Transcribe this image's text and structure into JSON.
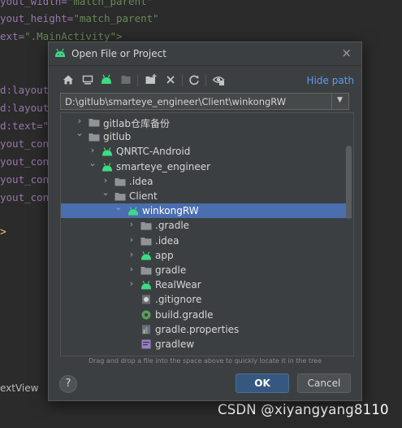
{
  "editor": {
    "lines": [
      {
        "a": "yout_width=",
        "v": "\"match_parent\""
      },
      {
        "a": "yout_height=",
        "v": "\"match_parent\""
      },
      {
        "a": "ext=",
        "v": "\".MainActivity\">"
      },
      {
        "a": "",
        "v": ""
      },
      {
        "a": "d:layout",
        "v": ""
      },
      {
        "a": "d:layout",
        "v": ""
      },
      {
        "a": "d:text=\"",
        "v": ""
      },
      {
        "a": "yout_con",
        "v": ""
      },
      {
        "a": "yout_con",
        "v": ""
      },
      {
        "a": "yout_con",
        "v": ""
      },
      {
        "a": "yout_con",
        "v": ""
      }
    ],
    "arrow": ">",
    "bottom_tab": "extView"
  },
  "dialog": {
    "title": "Open File or Project",
    "close": "×",
    "hide_path": "Hide path",
    "path_value": "D:\\gitlub\\smarteye_engineer\\Client\\winkongRW",
    "tree": [
      {
        "label": "gitlab仓库备份",
        "indent": 0,
        "chev": "›",
        "icon": "folder"
      },
      {
        "label": "gitlub",
        "indent": 0,
        "chev": "⌄",
        "icon": "folder"
      },
      {
        "label": "QNRTC-Android",
        "indent": 1,
        "chev": "›",
        "icon": "android"
      },
      {
        "label": "smarteye_engineer",
        "indent": 1,
        "chev": "⌄",
        "icon": "android"
      },
      {
        "label": ".idea",
        "indent": 2,
        "chev": "›",
        "icon": "folder"
      },
      {
        "label": "Client",
        "indent": 2,
        "chev": "⌄",
        "icon": "folder"
      },
      {
        "label": "winkongRW",
        "indent": 3,
        "chev": "⌄",
        "icon": "android",
        "selected": true
      },
      {
        "label": ".gradle",
        "indent": 4,
        "chev": "›",
        "icon": "folder"
      },
      {
        "label": ".idea",
        "indent": 4,
        "chev": "›",
        "icon": "folder"
      },
      {
        "label": "app",
        "indent": 4,
        "chev": "›",
        "icon": "android"
      },
      {
        "label": "gradle",
        "indent": 4,
        "chev": "›",
        "icon": "folder"
      },
      {
        "label": "RealWear",
        "indent": 4,
        "chev": "›",
        "icon": "android"
      },
      {
        "label": ".gitignore",
        "indent": 4,
        "chev": "",
        "icon": "gitignore"
      },
      {
        "label": "build.gradle",
        "indent": 4,
        "chev": "",
        "icon": "gradle"
      },
      {
        "label": "gradle.properties",
        "indent": 4,
        "chev": "",
        "icon": "properties"
      },
      {
        "label": "gradlew",
        "indent": 4,
        "chev": "",
        "icon": "script"
      }
    ],
    "hint": "Drag and drop a file into the space above to quickly locate it in the tree",
    "help": "?",
    "ok": "OK",
    "cancel": "Cancel"
  },
  "watermark": "CSDN @xiyangyang8110",
  "colors": {
    "selection": "#4b6eaf",
    "android_green": "#3ddc84",
    "link": "#589df6"
  }
}
